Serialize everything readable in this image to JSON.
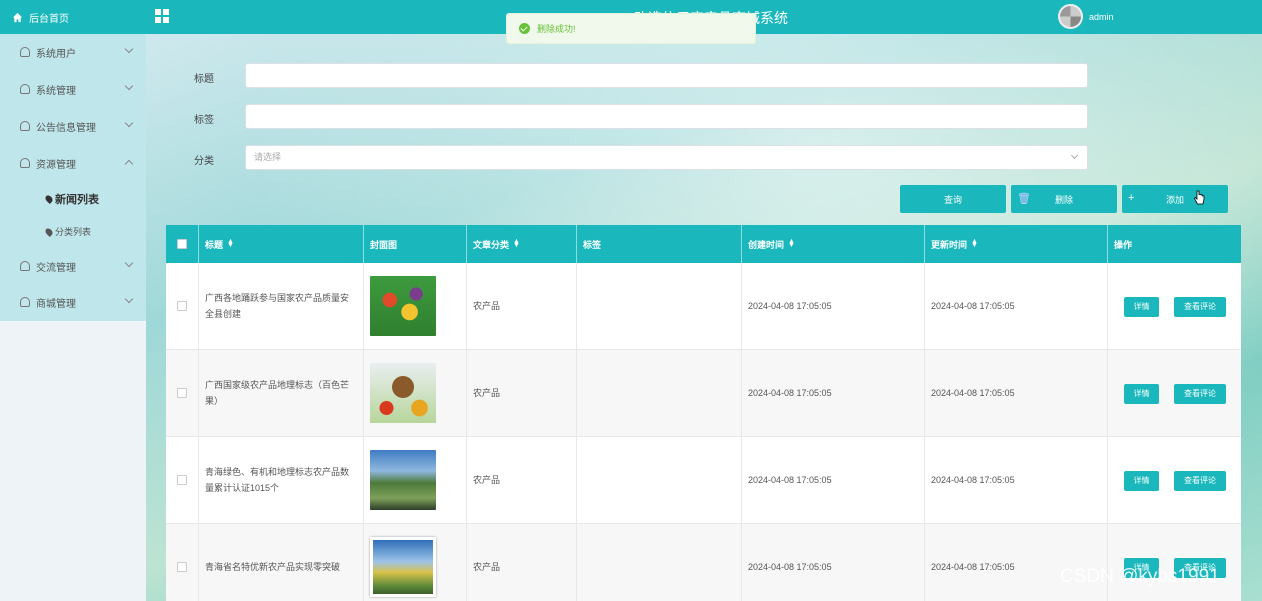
{
  "topbar": {
    "brand": "后台首页",
    "app_title": "改造信用农产品商城系统",
    "user": "admin"
  },
  "toast": {
    "message": "删除成功!"
  },
  "sidebar": {
    "items": [
      {
        "label": "系统用户"
      },
      {
        "label": "系统管理"
      },
      {
        "label": "公告信息管理"
      },
      {
        "label": "资源管理"
      },
      {
        "label": "交流管理"
      },
      {
        "label": "商城管理"
      }
    ],
    "sub_items": [
      {
        "label": "新闻列表"
      },
      {
        "label": "分类列表"
      }
    ]
  },
  "filters": {
    "title_label": "标题",
    "tags_label": "标签",
    "category_label": "分类",
    "category_placeholder": "请选择"
  },
  "actions": {
    "query": "查询",
    "delete": "删除",
    "add": "添加"
  },
  "table": {
    "headers": [
      "标题",
      "封面图",
      "文章分类",
      "标签",
      "创建时间",
      "更新时间",
      "操作"
    ],
    "rows": [
      {
        "title": "广西各地踊跃参与国家农产品质量安全县创建",
        "category": "农产品",
        "tags": "",
        "created": "2024-04-08 17:05:05",
        "updated": "2024-04-08 17:05:05"
      },
      {
        "title": "广西国家级农产品地理标志（百色芒果）",
        "category": "农产品",
        "tags": "",
        "created": "2024-04-08 17:05:05",
        "updated": "2024-04-08 17:05:05"
      },
      {
        "title": "青海绿色、有机和地理标志农产品数量累计认证1015个",
        "category": "农产品",
        "tags": "",
        "created": "2024-04-08 17:05:05",
        "updated": "2024-04-08 17:05:05"
      },
      {
        "title": "青海省名特优新农产品实现零突破",
        "category": "农产品",
        "tags": "",
        "created": "2024-04-08 17:05:05",
        "updated": "2024-04-08 17:05:05"
      }
    ],
    "detail_label": "详情",
    "comments_label": "查看评论"
  },
  "watermark": "CSDN @kybs1991"
}
